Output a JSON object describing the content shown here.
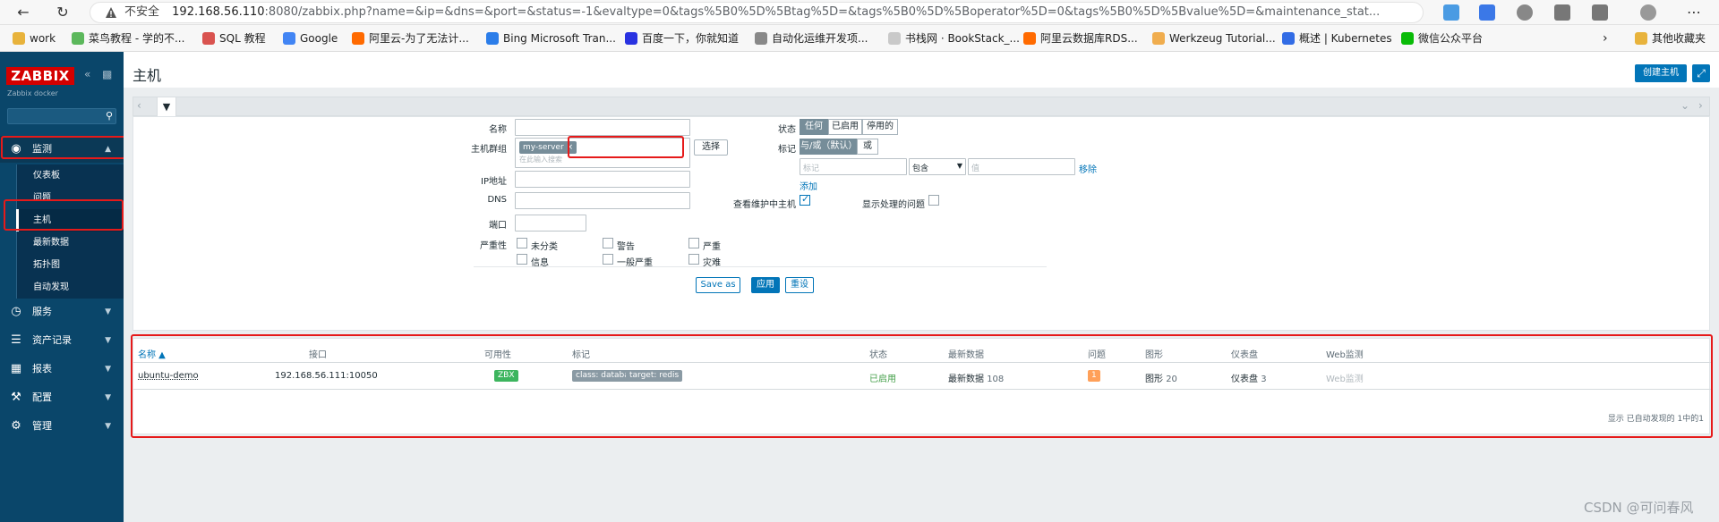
{
  "browser": {
    "insecure_label": "不安全",
    "url_host": "192.168.56.110",
    "url_rest": ":8080/zabbix.php?name=&ip=&dns=&port=&status=-1&evaltype=0&tags%5B0%5D%5Btag%5D=&tags%5B0%5D%5Boperator%5D=0&tags%5B0%5D%5Bvalue%5D=&maintenance_stat...",
    "bookmarks": [
      "work",
      "菜鸟教程 - 学的不...",
      "SQL 教程",
      "Google",
      "阿里云-为了无法计...",
      "Bing Microsoft Tran...",
      "百度一下，你就知道",
      "自动化运维开发项...",
      "书栈网 · BookStack_...",
      "阿里云数据库RDS...",
      "Werkzeug Tutorial...",
      "概述 | Kubernetes",
      "微信公众平台"
    ],
    "other_bookmarks": "其他收藏夹"
  },
  "sidebar": {
    "logo": "ZABBIX",
    "subtitle": "Zabbix docker",
    "menu": [
      {
        "label": "监测",
        "icon": "eye-icon"
      },
      {
        "label": "服务",
        "icon": "clock-icon"
      },
      {
        "label": "资产记录",
        "icon": "list-icon"
      },
      {
        "label": "报表",
        "icon": "bar-chart-icon"
      },
      {
        "label": "配置",
        "icon": "wrench-icon"
      },
      {
        "label": "管理",
        "icon": "gear-icon"
      }
    ],
    "monitoring_items": [
      "仪表板",
      "问题",
      "主机",
      "最新数据",
      "拓扑图",
      "自动发现"
    ]
  },
  "header": {
    "title": "主机",
    "create_button": "创建主机"
  },
  "filter": {
    "name_label": "名称",
    "hostgroup_label": "主机群组",
    "hostgroup_chip": "my-server",
    "hostgroup_placeholder": "在此输入搜索",
    "select_button": "选择",
    "ip_label": "IP地址",
    "dns_label": "DNS",
    "port_label": "端口",
    "severity_label": "严重性",
    "severities": [
      "未分类",
      "警告",
      "严重",
      "信息",
      "一般严重",
      "灾难"
    ],
    "status_label": "状态",
    "status_options": [
      "任何",
      "已启用",
      "停用的"
    ],
    "tags_label": "标记",
    "tags_options": [
      "与/或（默认）",
      "或"
    ],
    "tag_placeholder": "标记",
    "tag_operator": "包含",
    "value_placeholder": "值",
    "remove_link": "移除",
    "add_link": "添加",
    "maintenance_label": "查看维护中主机",
    "maintenance_checked": true,
    "suppressed_label": "显示处理的问题",
    "suppressed_checked": false,
    "save_as_button": "Save as",
    "apply_button": "应用",
    "reset_button": "重设"
  },
  "table": {
    "headers": [
      "名称 ▲",
      "接口",
      "可用性",
      "标记",
      "状态",
      "最新数据",
      "问题",
      "图形",
      "仪表盘",
      "Web监测"
    ],
    "rows": [
      {
        "name": "ubuntu-demo",
        "interface": "192.168.56.111:10050",
        "availability": "ZBX",
        "tags": [
          "class: database",
          "target: redis"
        ],
        "status": "已启用",
        "latest_data": "最新数据",
        "latest_data_count": "108",
        "problems": "1",
        "graphs": "图形",
        "graphs_count": "20",
        "dashboards": "仪表盘",
        "dashboards_count": "3",
        "web": "Web监测"
      }
    ],
    "footer": "显示 已自动发现的 1中的1"
  },
  "watermark": "CSDN @可问春风",
  "colors": {
    "sidebar": "#0a466a",
    "accent": "#0275b8",
    "logo": "#d40000",
    "enabled": "#429e47",
    "zbx": "#59db8f",
    "problem": "#ffa059",
    "highlight": "#e61a1a"
  }
}
